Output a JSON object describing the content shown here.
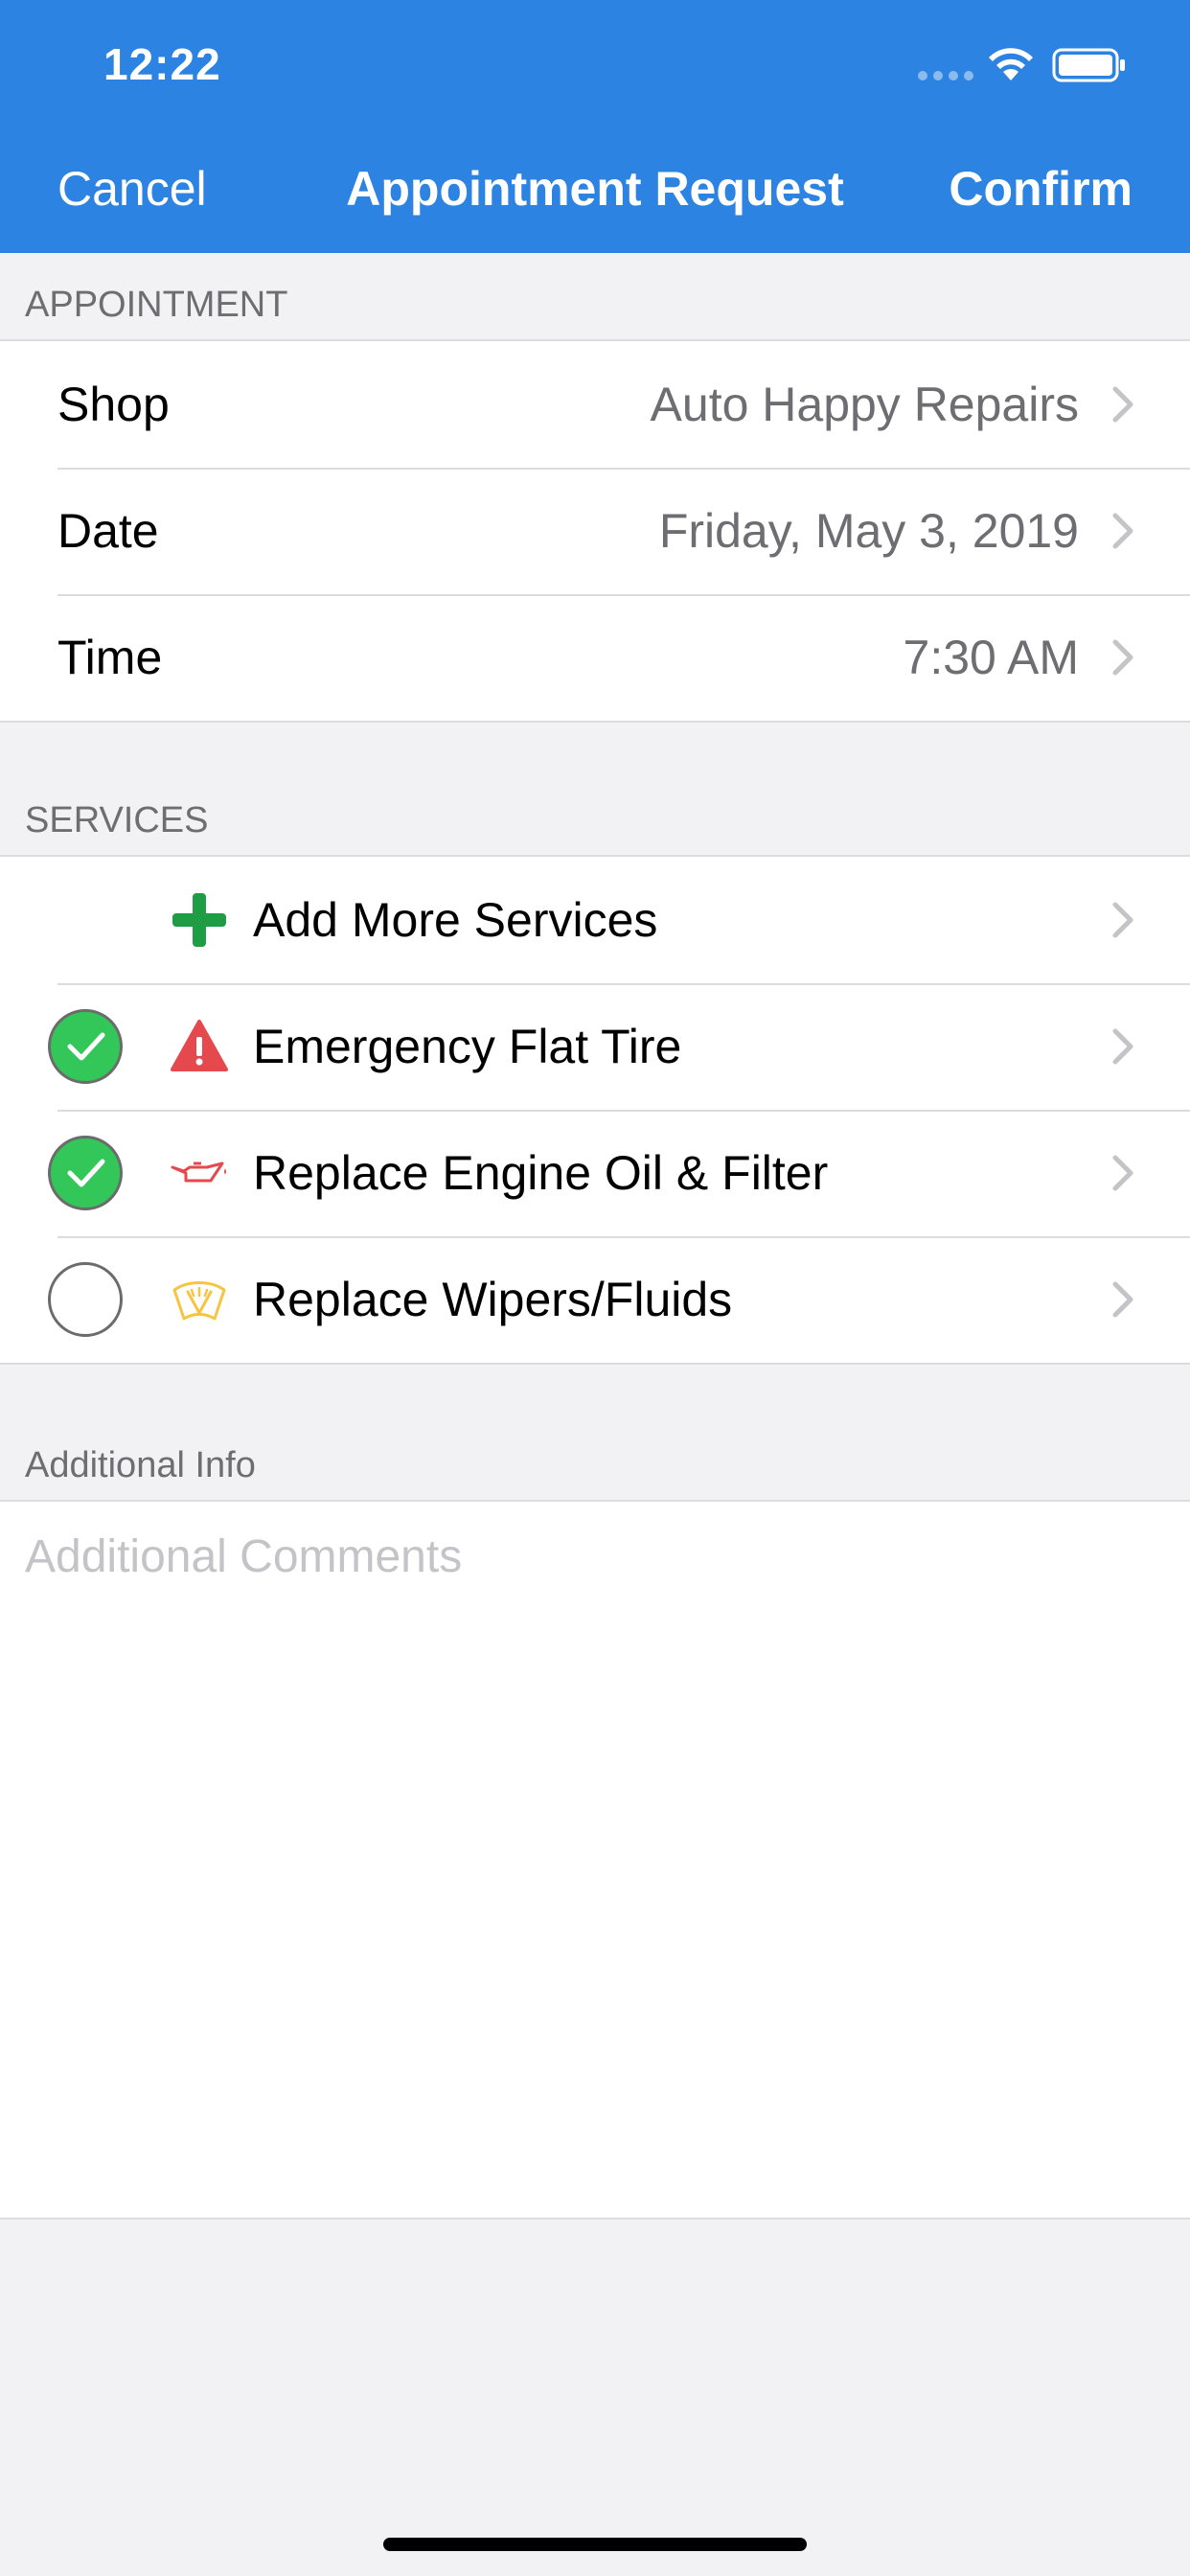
{
  "status_bar": {
    "time": "12:22"
  },
  "nav": {
    "cancel_label": "Cancel",
    "title": "Appointment Request",
    "confirm_label": "Confirm"
  },
  "appointment": {
    "header": "APPOINTMENT",
    "rows": [
      {
        "label": "Shop",
        "value": "Auto Happy Repairs"
      },
      {
        "label": "Date",
        "value": "Friday, May 3, 2019"
      },
      {
        "label": "Time",
        "value": "7:30 AM"
      }
    ]
  },
  "services": {
    "header": "SERVICES",
    "add_label": "Add More Services",
    "items": [
      {
        "label": "Emergency Flat Tire",
        "checked": true,
        "icon": "warning-icon",
        "icon_color": "#e5484d"
      },
      {
        "label": "Replace Engine Oil & Filter",
        "checked": true,
        "icon": "oil-can-icon",
        "icon_color": "#e5484d"
      },
      {
        "label": "Replace Wipers/Fluids",
        "checked": false,
        "icon": "windshield-wiper-icon",
        "icon_color": "#f5c542"
      }
    ]
  },
  "additional_info": {
    "header": "Additional Info",
    "placeholder": "Additional Comments"
  },
  "colors": {
    "accent": "#2d83e1",
    "check_green": "#33c659",
    "add_green": "#1f9d45"
  }
}
